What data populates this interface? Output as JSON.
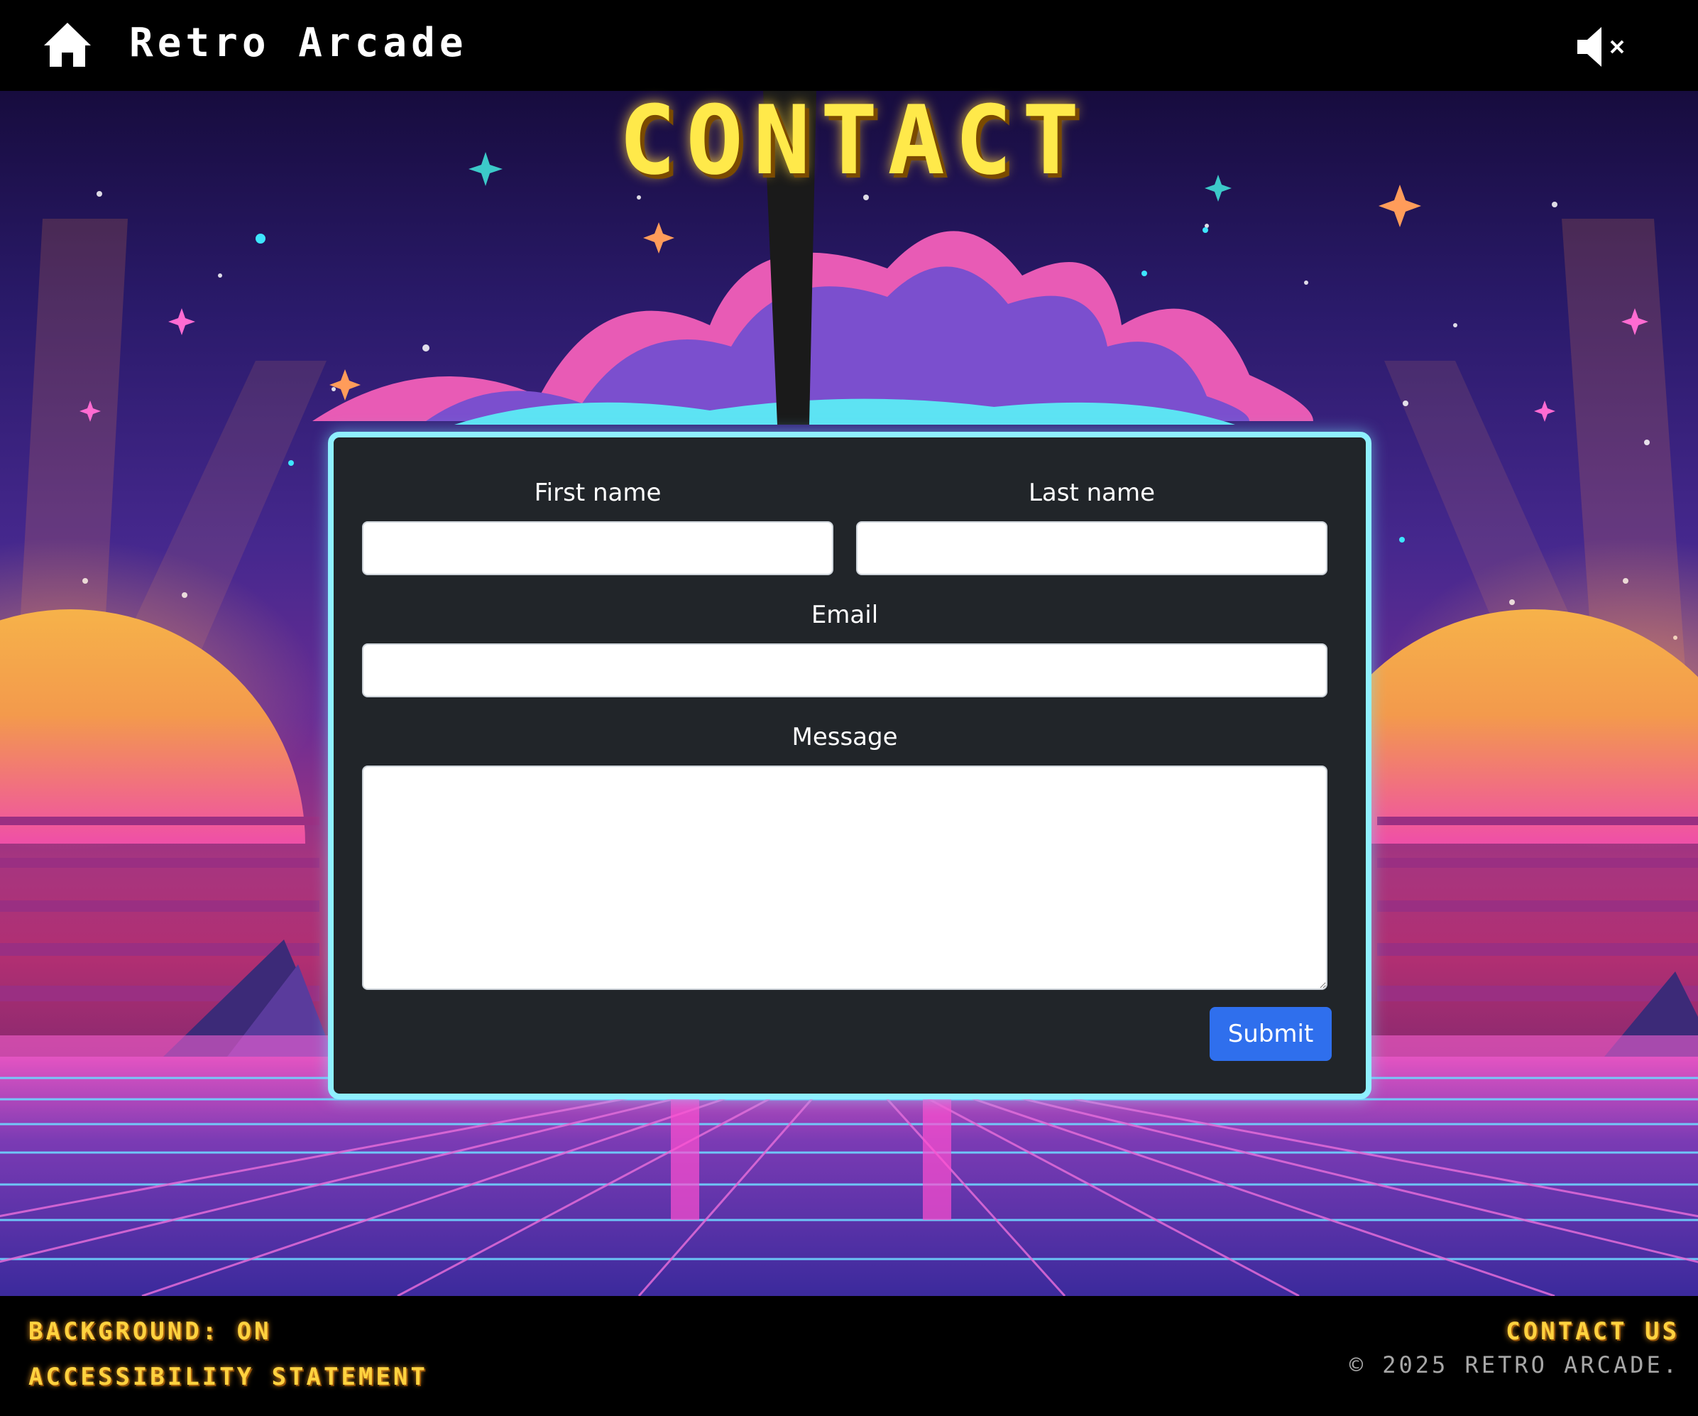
{
  "header": {
    "site_title": "Retro Arcade",
    "home_icon": "home-icon",
    "mute_icon": "speaker-muted-icon"
  },
  "page_title": "CONTACT",
  "form": {
    "first_name_label": "First name",
    "first_name_value": "",
    "last_name_label": "Last name",
    "last_name_value": "",
    "email_label": "Email",
    "email_value": "",
    "message_label": "Message",
    "message_value": "",
    "submit_label": "Submit"
  },
  "footer": {
    "background_toggle": "BACKGROUND: ON",
    "accessibility_link": "ACCESSIBILITY STATEMENT",
    "contact_link": "CONTACT US",
    "copyright": "© 2025 RETRO ARCADE."
  },
  "colors": {
    "title_yellow": "#ffe94a",
    "card_border": "#8ff0ff",
    "card_background": "#212529",
    "submit_blue": "#2f6fed",
    "footer_link": "#ffd23f"
  }
}
